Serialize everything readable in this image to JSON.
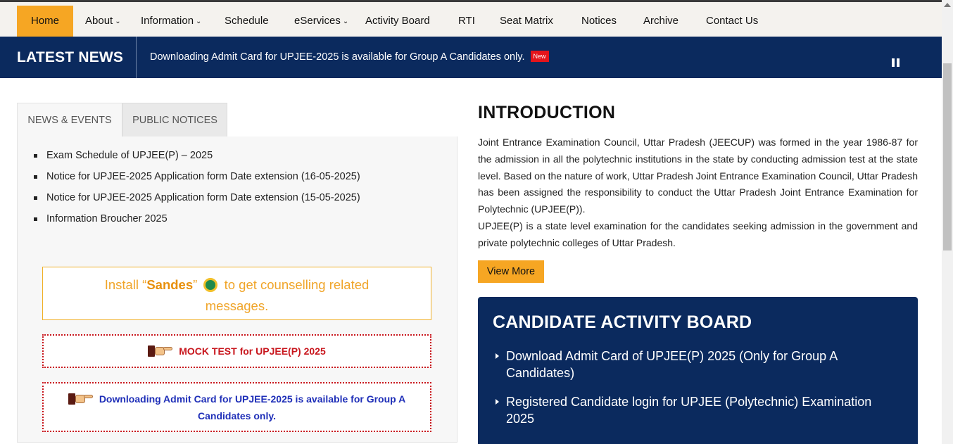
{
  "nav": {
    "items": [
      {
        "label": "Home",
        "active": true
      },
      {
        "label": "About",
        "dropdown": true
      },
      {
        "label": "Information",
        "dropdown": true
      },
      {
        "label": "Schedule"
      },
      {
        "label": "eServices",
        "dropdown": true
      },
      {
        "label": "Activity Board"
      },
      {
        "label": "RTI"
      },
      {
        "label": "Seat Matrix"
      },
      {
        "label": "Notices"
      },
      {
        "label": "Archive"
      },
      {
        "label": "Contact Us"
      }
    ],
    "active_color": "#f6a623"
  },
  "news": {
    "title": "LATEST NEWS",
    "ticker": "Downloading Admit Card for UPJEE-2025 is available for Group A Candidates only.",
    "badge": "New",
    "bar_color": "#0b2a5e"
  },
  "tabs": {
    "news_events": "NEWS & EVENTS",
    "public_notices": "PUBLIC NOTICES"
  },
  "news_events": [
    "Exam Schedule of UPJEE(P) – 2025",
    "Notice for UPJEE-2025 Application form Date extension (16-05-2025)",
    "Notice for UPJEE-2025 Application form Date extension (15-05-2025)",
    "Information Broucher 2025"
  ],
  "sandes": {
    "pre": "Install “",
    "app": "Sandes",
    "post": "”",
    "line1_rest": " to get counselling related",
    "line2": "messages."
  },
  "mock": {
    "label": "MOCK TEST for UPJEE(P) 2025"
  },
  "admit": {
    "line1": "Downloading Admit Card for UPJEE-2025 is available for Group A",
    "line2": "Candidates only."
  },
  "intro": {
    "title": "INTRODUCTION",
    "p1": "Joint Entrance Examination Council, Uttar Pradesh (JEECUP) was formed in the year 1986-87 for the admission in all the polytechnic institutions in the state by conducting admission test at the state level. Based on the nature of work, Uttar Pradesh Joint Entrance Examination Council, Uttar Pradesh has been assigned the responsibility to conduct the Uttar Pradesh Joint Entrance Examination for Polytechnic (UPJEE(P)).",
    "p2": "UPJEE(P) is a state level examination for the candidates seeking admission in the government and private polytechnic colleges of Uttar Pradesh.",
    "button": "View More"
  },
  "board": {
    "title": "CANDIDATE ACTIVITY BOARD",
    "items": [
      "Download Admit Card of UPJEE(P) 2025 (Only for Group A Candidates)",
      "Registered Candidate login for UPJEE (Polytechnic) Examination 2025"
    ]
  }
}
